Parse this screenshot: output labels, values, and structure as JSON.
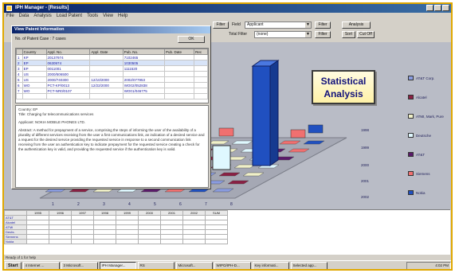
{
  "window": {
    "title": "IPH Manager - [Results]",
    "menu": [
      "File",
      "Data",
      "Analysis",
      "Load Patent",
      "Tools",
      "View",
      "Help"
    ]
  },
  "toolbar": {
    "filter_btn_1": "Filter",
    "field_label": "Field",
    "field_value": "Applicant",
    "filter_btn_2": "Filter",
    "analysis_btn": "Analysis",
    "total_filter_label": "Total Filter",
    "total_filter_value": "(none)",
    "filter_btn_3": "Filter",
    "sort_btn": "Sort",
    "cut_off_btn": "Cut Off"
  },
  "dialog": {
    "title": "View Patent Information",
    "count_label": "No. of Patent Case : 7 cases",
    "ok_label": "OK",
    "columns": [
      "",
      "Country",
      "Appl. No.",
      "Appl. Date",
      "Pub. No.",
      "Pub. Date",
      "Rec"
    ],
    "rows": [
      [
        "1",
        "KP",
        "20137974",
        "",
        "7102465",
        "",
        ""
      ],
      [
        "2",
        "EP",
        "0630974",
        "",
        "1030505",
        "",
        ""
      ],
      [
        "3",
        "EP",
        "0011001",
        "",
        "1111520",
        "",
        ""
      ],
      [
        "4",
        "US",
        "2000/506500",
        "",
        "",
        "",
        ""
      ],
      [
        "5",
        "US",
        "2000/740300",
        "12/10/2000",
        "2002/077953",
        "",
        ""
      ],
      [
        "6",
        "WO",
        "PCT-KP/0013",
        "12/22/2000",
        "WO02/052838",
        "",
        ""
      ],
      [
        "7",
        "WO",
        "PCT-NR0/0107",
        "",
        "WO01/046775",
        "",
        ""
      ]
    ],
    "detail": {
      "country": "Country: EP",
      "title": "Title: Charging for telecommunications services",
      "applicant": "Applicant: NOKIA MOBILE PHONES LTD.",
      "abstract": "Abstract: A method for prepayment of a service, comprising the steps of informing the user of the availability of a plurality of different services receiving from the user a first communications link, an indication of a desired service and a request for the desired service providing the requested service in response to a second communication link receiving from the user an authentication key to indicate prepayment for the requested service creating a check for the authentication key is valid, and providing the requested service if the authentication key is valid."
    }
  },
  "overlay": {
    "line1": "Statistical",
    "line2": "Analysis"
  },
  "chart_data": {
    "type": "bar",
    "categories": [
      "1",
      "2",
      "3",
      "4",
      "5",
      "6",
      "7",
      "8"
    ],
    "series_years": [
      "1998",
      "1999",
      "2000",
      "2001",
      "2002"
    ],
    "legend": [
      {
        "name": "AT&T Corp.",
        "color": "#8a9ce0"
      },
      {
        "name": "Alcatel",
        "color": "#8a2044"
      },
      {
        "name": "ATMI, Mark, Pure",
        "color": "#f0f0c8"
      },
      {
        "name": "Deutsche",
        "color": "#dff8ff"
      },
      {
        "name": "AT&T",
        "color": "#5a1a6a"
      },
      {
        "name": "Siemens",
        "color": "#f07070"
      },
      {
        "name": "Nokia",
        "color": "#2050c0"
      }
    ],
    "peak": {
      "category": "6",
      "series": "Nokia"
    }
  },
  "grid": {
    "headers": [
      "",
      "1995",
      "1996",
      "1997",
      "1998",
      "1999",
      "2000",
      "2001",
      "2002",
      "SUM"
    ],
    "row_labels": [
      "AT&T",
      "Alcatel",
      "ATMI",
      "Deuts.",
      "Siemens",
      "Nokia"
    ]
  },
  "status_text": "Ready  of 1 for help",
  "taskbar": {
    "start": "Start",
    "tasks": [
      "4 Internet ...",
      "3 Microsoft...",
      "IPH Manager...",
      "RS",
      "Microsoft...",
      "WIPO/IPH-D...",
      "Key informati...",
      "Selected app..."
    ],
    "clock": "4:02 PM"
  }
}
